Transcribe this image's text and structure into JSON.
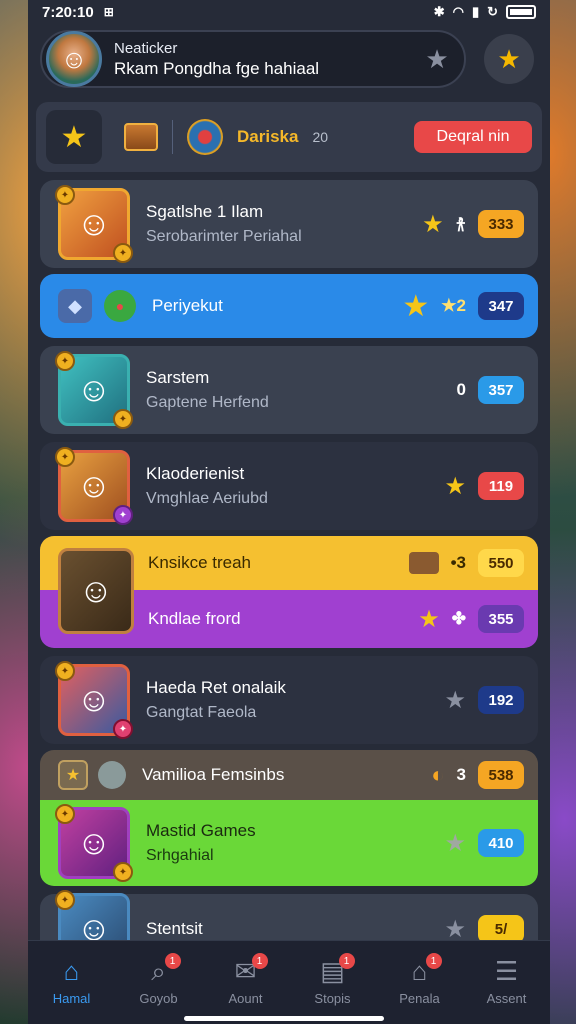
{
  "status_bar": {
    "time": "7:20:10",
    "extra": "⊞"
  },
  "profile": {
    "name": "Neaticker",
    "subtitle": "Rkam Pongdha fge hahiaal"
  },
  "toolbar": {
    "label": "Dariska",
    "count": "20",
    "action": "Deqral nin"
  },
  "rows": [
    {
      "title": "Sgatlshe 1 Ilam",
      "subtitle": "Serobarimter Periahal",
      "extra": "𐀪",
      "score": "333"
    },
    {
      "title": "Periyekut",
      "subtitle": "",
      "extra": "★2",
      "score": "347"
    },
    {
      "title": "Sarstem",
      "subtitle": "Gaptene Herfend",
      "extra": "0",
      "score": "357"
    },
    {
      "title": "Klaoderienist",
      "subtitle": "Vmghlae Aeriubd",
      "extra": "",
      "score": "119"
    },
    {
      "title": "Knsikce treah",
      "subtitle": "",
      "extra": "•3",
      "score": "550"
    },
    {
      "title": "Kndlae frord",
      "subtitle": "",
      "extra": "✤",
      "score": "355"
    },
    {
      "title": "Haeda Ret onalaik",
      "subtitle": "Gangtat Faeola",
      "extra": "",
      "score": "192"
    },
    {
      "title": "Vamilioa Femsinbs",
      "subtitle": "",
      "extra": "3",
      "score": "538"
    },
    {
      "title": "Mastid Games",
      "subtitle": "Srhgahial",
      "extra": "",
      "score": "410"
    },
    {
      "title": "Stentsit",
      "subtitle": "",
      "extra": "",
      "score": "5/"
    }
  ],
  "nav": [
    {
      "label": "Hamal",
      "icon": "home-icon",
      "badge": ""
    },
    {
      "label": "Goyob",
      "icon": "search-icon",
      "badge": "1"
    },
    {
      "label": "Aount",
      "icon": "mail-icon",
      "badge": "1"
    },
    {
      "label": "Stopis",
      "icon": "chart-icon",
      "badge": "1"
    },
    {
      "label": "Penala",
      "icon": "house-icon",
      "badge": "1"
    },
    {
      "label": "Assent",
      "icon": "database-icon",
      "badge": ""
    }
  ],
  "colors": {
    "accent_blue": "#2a8ae8",
    "accent_yellow": "#f5c030",
    "accent_purple": "#a040d0",
    "accent_green": "#6ad838",
    "nav_active": "#3a9af0"
  }
}
